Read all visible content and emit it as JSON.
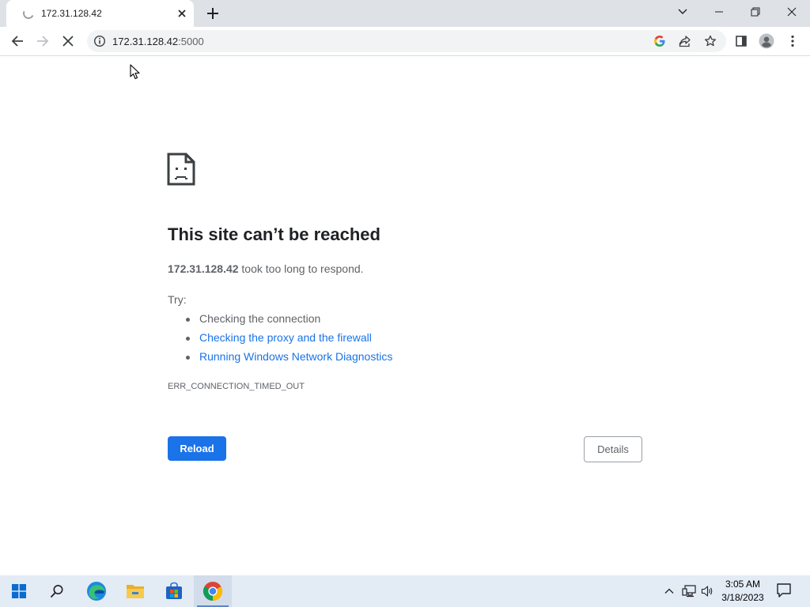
{
  "browser": {
    "tab_title": "172.31.128.42",
    "url_host": "172.31.128.42",
    "url_port": ":5000"
  },
  "error_page": {
    "title": "This site can’t be reached",
    "host": "172.31.128.42",
    "message": " took too long to respond.",
    "try_label": "Try:",
    "suggestions": [
      "Checking the connection",
      "Checking the proxy and the firewall",
      "Running Windows Network Diagnostics"
    ],
    "error_code": "ERR_CONNECTION_TIMED_OUT",
    "reload_label": "Reload",
    "details_label": "Details"
  },
  "taskbar": {
    "time": "3:05 AM",
    "date": "3/18/2023"
  },
  "colors": {
    "accent": "#1a73e8",
    "tabstrip": "#dee1e6",
    "taskbar": "#e3ebf5"
  }
}
